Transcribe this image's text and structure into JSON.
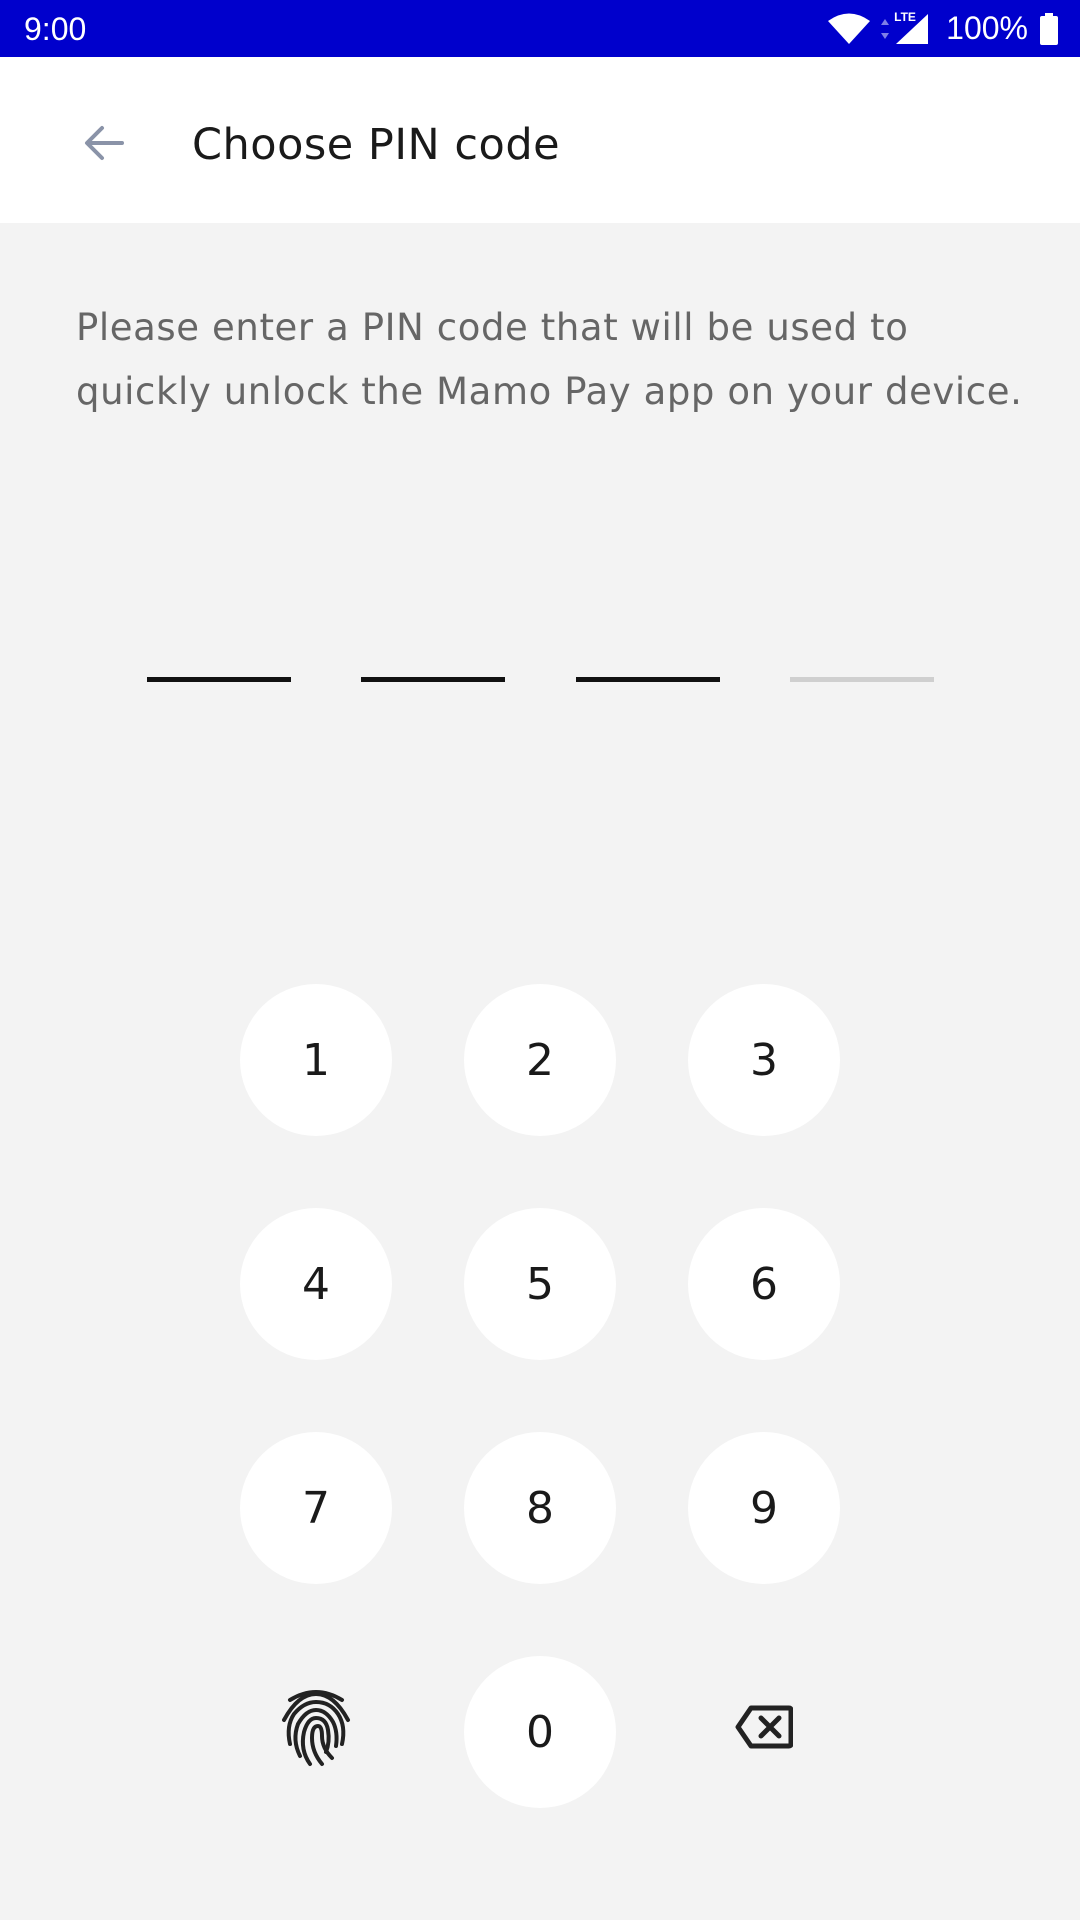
{
  "status_bar": {
    "time": "9:00",
    "battery": "100%",
    "network_label": "LTE",
    "color": "#0000cc",
    "icons": [
      "wifi-icon",
      "cell-signal-icon",
      "battery-icon"
    ]
  },
  "app_bar": {
    "title": "Choose PIN code",
    "back_icon": "arrow-left-icon"
  },
  "description": "Please enter a PIN code that will be used to quickly unlock the Mamo Pay app on your device.",
  "pin": {
    "length": 4,
    "filled": 3
  },
  "keypad": {
    "keys": [
      "1",
      "2",
      "3",
      "4",
      "5",
      "6",
      "7",
      "8",
      "9",
      "0"
    ],
    "biometric_icon": "fingerprint-icon",
    "delete_icon": "backspace-icon"
  }
}
